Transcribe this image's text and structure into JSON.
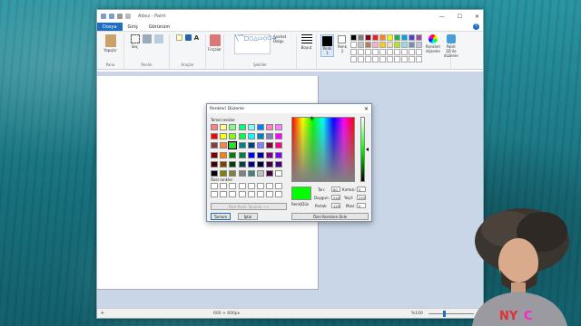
{
  "window": {
    "title": "Adsız - Paint",
    "min": "—",
    "max": "☐",
    "close": "✕"
  },
  "tabs": [
    {
      "label": "Dosya"
    },
    {
      "label": "Giriş"
    },
    {
      "label": "Görünüm"
    }
  ],
  "ribbon": {
    "groups": [
      "Pano",
      "Resim",
      "Araçlar",
      "Şekiller",
      "Renkler"
    ],
    "paste": "Yapıştır",
    "select": "Seç",
    "brushes": "Fırçalar",
    "outline": "Anahat",
    "fill": "Dolgu",
    "size": "Boyut",
    "color1": "Renk 1",
    "color2": "Renk 2",
    "edit_colors": "Renkleri düzenle",
    "paint3d": "Paint 3D ile düzenle"
  },
  "palette_colors": [
    "#000000",
    "#7f7f7f",
    "#880015",
    "#ed1c24",
    "#ff7f27",
    "#fff200",
    "#22b14c",
    "#00a2e8",
    "#3f48cc",
    "#a349a4",
    "#ffffff",
    "#c3c3c3",
    "#b97a57",
    "#ffaec9",
    "#ffc90e",
    "#efe4b0",
    "#b5e61d",
    "#99d9ea",
    "#7092be",
    "#c8bfe7"
  ],
  "status": {
    "dimensions": "600 × 600px",
    "zoom": "%100"
  },
  "dialog": {
    "title": "Renkleri Düzenle",
    "close": "✕",
    "basic_label": "Temel renkler",
    "custom_label": "Özel renkler",
    "define_custom": "Özel Renk Tanımla >>",
    "ok": "Tamam",
    "cancel": "İptal",
    "add_custom": "Özel Renklere Ekle",
    "solid_label": "Renk|Düz",
    "hue_label": "Ton:",
    "hue": "80",
    "sat_label": "Doygun:",
    "sat": "240",
    "lum_label": "Parlak:",
    "lum": "120",
    "red_label": "Kırmızı:",
    "red": "0",
    "green_label": "Yeşil:",
    "green": "255",
    "blue_label": "Mavi:",
    "blue": "0",
    "selected_color": "#00ff00",
    "basic_colors": [
      "#ff8080",
      "#ffff80",
      "#80ff80",
      "#00ff80",
      "#80ffff",
      "#0080ff",
      "#ff80c0",
      "#ff80ff",
      "#ff0000",
      "#ffff00",
      "#80ff00",
      "#00ff40",
      "#00ffff",
      "#0080c0",
      "#8080c0",
      "#ff00ff",
      "#804040",
      "#ff8040",
      "#00ff00",
      "#008080",
      "#004080",
      "#8080ff",
      "#800040",
      "#ff0080",
      "#800000",
      "#ff8000",
      "#008000",
      "#008040",
      "#0000ff",
      "#0000a0",
      "#800080",
      "#8000ff",
      "#400000",
      "#804000",
      "#004000",
      "#004040",
      "#000080",
      "#000040",
      "#400040",
      "#400080",
      "#000000",
      "#808000",
      "#808040",
      "#808080",
      "#408080",
      "#c0c0c0",
      "#400040",
      "#ffffff"
    ]
  }
}
